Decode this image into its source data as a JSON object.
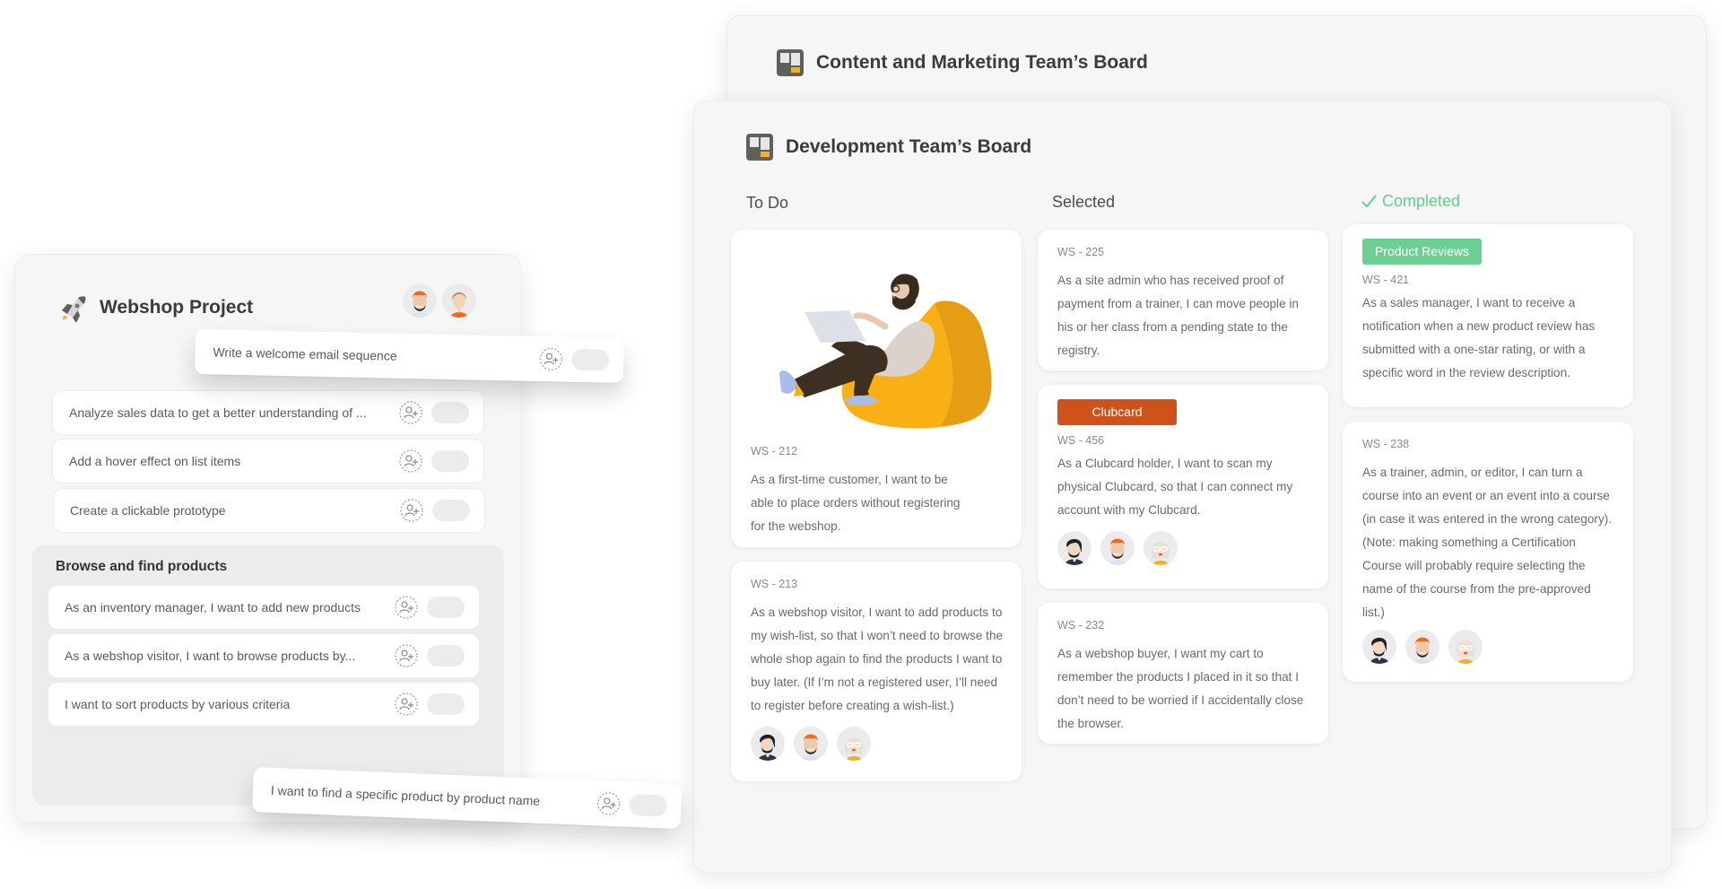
{
  "colors": {
    "accent_yellow": "#f7b21b",
    "completed_green": "#5fcf8e",
    "tag_clubcard": "#d0521b",
    "tag_product_reviews": "#6ccf93",
    "board_bg": "#f6f6f6"
  },
  "webshop": {
    "title": "Webshop Project",
    "icon": "rocket-icon",
    "members": [
      "avatar-man-orange-beanie",
      "avatar-woman-orange-shirt"
    ],
    "tasks": [
      {
        "label": "Analyze sales data to get a better understanding of ..."
      },
      {
        "label": "Add a hover effect on list items"
      },
      {
        "label": "Create a clickable prototype"
      }
    ],
    "group": {
      "title": "Browse and find products",
      "tasks": [
        {
          "label": "As an inventory manager, I want to add new products"
        },
        {
          "label": "As a webshop visitor, I want to browse products by..."
        },
        {
          "label": "I want to sort products by various criteria"
        }
      ]
    },
    "floating_cards": [
      {
        "label": "Write a welcome email sequence"
      },
      {
        "label": "I want to find a specific product by product name"
      }
    ]
  },
  "boards": {
    "back": {
      "title": "Content and Marketing Team’s Board",
      "icon": "board-icon"
    },
    "front": {
      "title": "Development Team’s Board",
      "icon": "board-icon",
      "columns": [
        {
          "title": "To Do",
          "cards": [
            {
              "id": "WS - 212",
              "illustration": "person-on-beanbag-illustration",
              "text": "As a first-time customer, I want to be able to place orders without registering for the webshop."
            },
            {
              "id": "WS - 213",
              "text": "As a webshop visitor, I want to add products to my wish-list, so that I won’t need to browse the whole shop again to find the products I want to buy later. (If I’m not a registered user, I’ll need to register before creating a wish-list.)",
              "avatars": [
                "avatar-man-dark-hair",
                "avatar-man-orange-beanie",
                "avatar-woman-glasses"
              ]
            }
          ]
        },
        {
          "title": "Selected",
          "cards": [
            {
              "id": "WS - 225",
              "text": "As a site admin who has received proof of payment from a trainer, I can move people in his or her class from a pending state to the registry."
            },
            {
              "id": "WS - 456",
              "tag": "Clubcard",
              "text": "As a Clubcard holder, I want to scan my physical Clubcard, so that I can connect my account with my Clubcard.",
              "avatars": [
                "avatar-man-dark-hair",
                "avatar-man-orange-beanie",
                "avatar-woman-glasses"
              ]
            },
            {
              "id": "WS - 232",
              "text": "As a webshop buyer, I want my cart to remember the products I placed in it so that I don’t need to be worried if I accidentally close the browser."
            }
          ]
        },
        {
          "title": "Completed",
          "status_icon": "check-icon",
          "cards": [
            {
              "id": "WS - 421",
              "tag": "Product Reviews",
              "text": "As a sales manager, I want to receive a notification when a new product review has submitted with a one-star rating, or with a specific word in the review description."
            },
            {
              "id": "WS - 238",
              "text": "As a trainer, admin, or editor, I can turn a course into an event or an event into a course (in case it was entered in the wrong category). (Note: making something a Certification Course will probably require selecting the name of the course from the pre-approved list.)",
              "avatars": [
                "avatar-man-dark-hair",
                "avatar-man-orange-beanie",
                "avatar-woman-glasses"
              ]
            }
          ]
        }
      ]
    }
  }
}
